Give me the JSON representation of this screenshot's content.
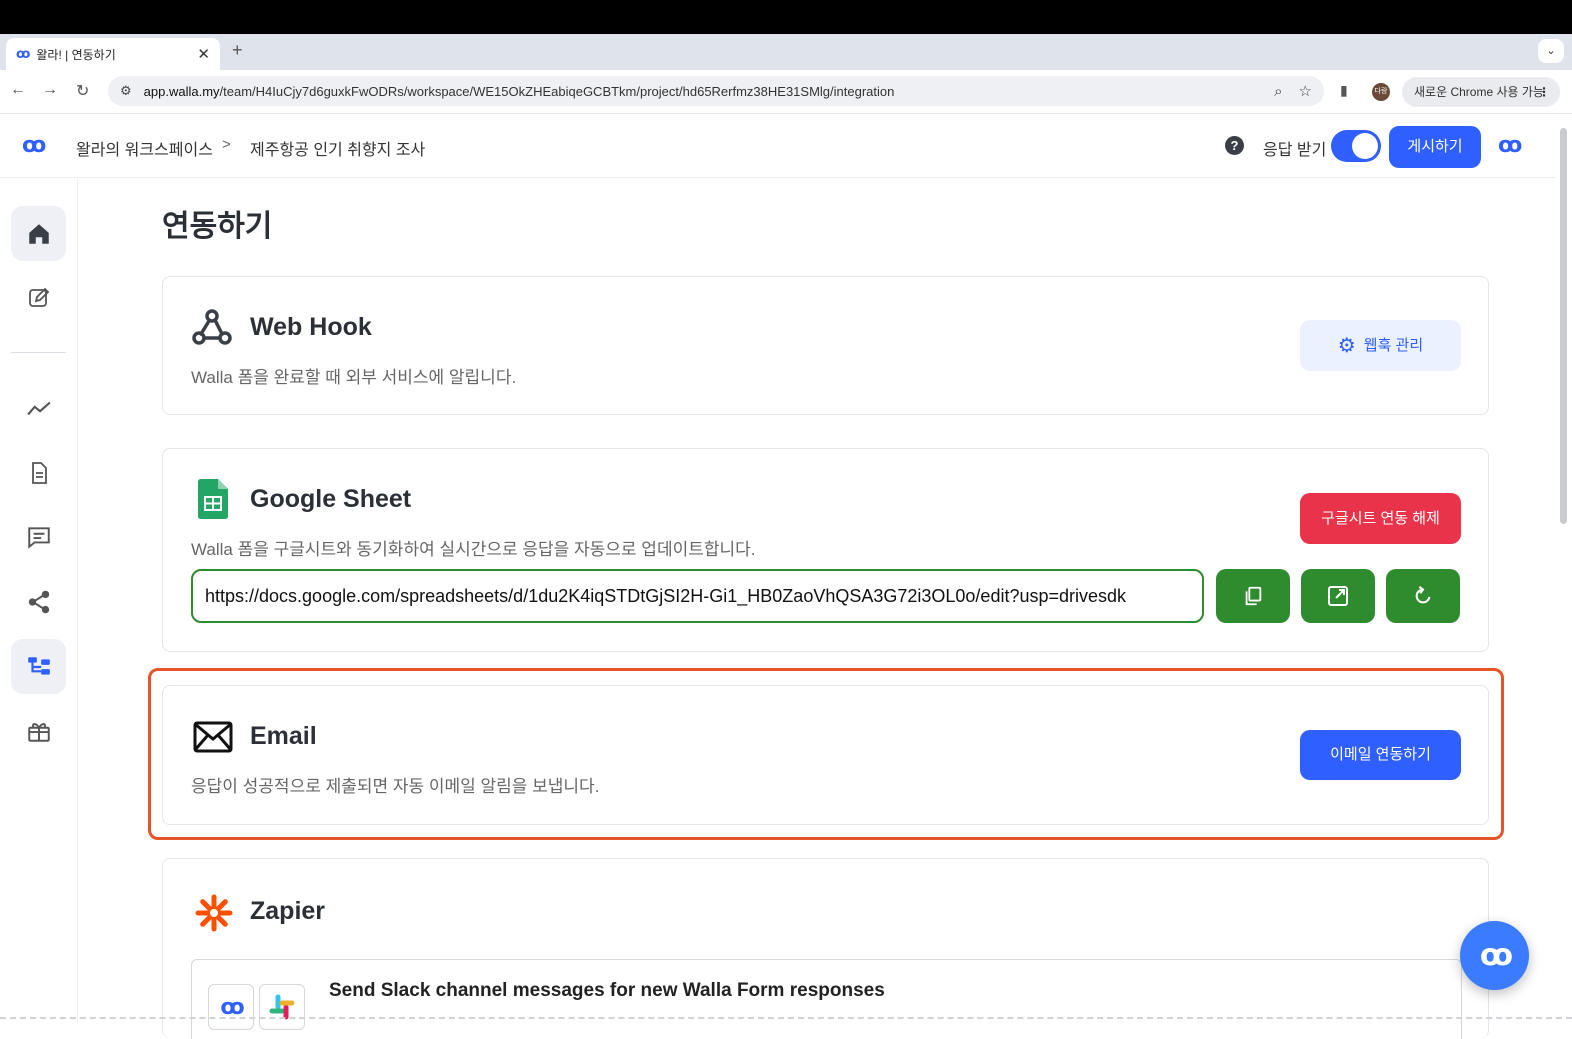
{
  "browser": {
    "tab_title": "왈라! | 연동하기",
    "tab_favicon": "ꝏ",
    "new_tab": "+",
    "url_domain": "app.walla.my",
    "url_path": "/team/H4IuCjy7d6guxkFwODRs/workspace/WE15OkZHEabiqeGCBTkm/project/hd65Rerfmz38HE31SMlg/integration",
    "profile_badge": "다랑",
    "chrome_pill": "새로운 Chrome 사용 가능"
  },
  "header": {
    "workspace": "왈라의 워크스페이스",
    "separator": ">",
    "project": "제주항공 인기 취향지 조사",
    "help": "?",
    "response_toggle_label": "응답 받기",
    "response_toggle_on": true,
    "publish_label": "게시하기",
    "logo": "ꝏ"
  },
  "page": {
    "title": "연동하기"
  },
  "integrations": {
    "webhook": {
      "title": "Web Hook",
      "description": "Walla 폼을 완료할 때 외부 서비스에 알립니다.",
      "button_label": "웹훅 관리"
    },
    "google_sheet": {
      "title": "Google Sheet",
      "description": "Walla 폼을 구글시트와 동기화하여 실시간으로 응답을 자동으로 업데이트합니다.",
      "unlink_label": "구글시트 연동 해제",
      "sheet_url": "https://docs.google.com/spreadsheets/d/1du2K4iqSTDtGjSI2H-Gi1_HB0ZaoVhQSA3G72i3OL0o/edit?usp=drivesdk"
    },
    "email": {
      "title": "Email",
      "description": "응답이 성공적으로 제출되면 자동 이메일 알림을 보냅니다.",
      "button_label": "이메일 연동하기"
    },
    "zapier": {
      "title": "Zapier",
      "zap_text": "Send Slack channel messages for new Walla Form responses"
    }
  },
  "colors": {
    "primary": "#2f5fff",
    "danger": "#e8334a",
    "success": "#2e8b2e",
    "highlight": "#e5552a",
    "zapier": "#ff4f00"
  }
}
